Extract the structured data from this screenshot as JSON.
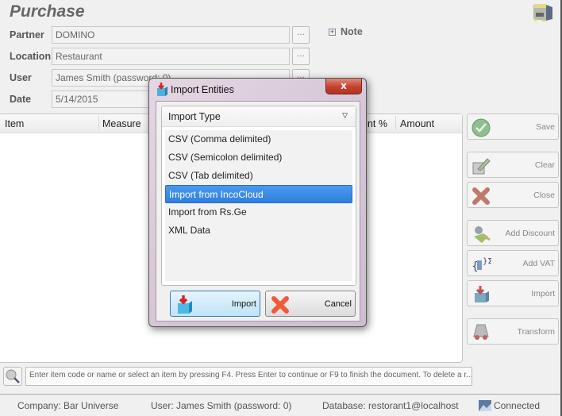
{
  "page": {
    "title": "Purchase"
  },
  "form": {
    "partner": {
      "label": "Partner",
      "value": "DOMINO",
      "browse": "..."
    },
    "location": {
      "label": "Location",
      "value": "Restaurant",
      "browse": "..."
    },
    "user": {
      "label": "User",
      "value": "James Smith (password: 0)",
      "browse": "..."
    },
    "date": {
      "label": "Date",
      "value": "5/14/2015"
    }
  },
  "note": {
    "label": "Note",
    "expander": "+"
  },
  "grid": {
    "columns": [
      "Item",
      "Measure",
      "Discount %",
      "Amount"
    ],
    "visible_partial_column": "unt %"
  },
  "side_buttons": [
    {
      "label": "Save",
      "icon": "check-icon"
    },
    {
      "label": "Clear",
      "icon": "edit-icon"
    },
    {
      "label": "Close",
      "icon": "x-icon"
    },
    {
      "label": "Add Discount",
      "icon": "discount-icon"
    },
    {
      "label": "Add VAT",
      "icon": "sigma-icon"
    },
    {
      "label": "Import",
      "icon": "import-icon"
    },
    {
      "label": "Transform",
      "icon": "transform-icon"
    }
  ],
  "search": {
    "placeholder": "Enter item code or name or select an item by pressing F4. Press Enter to continue or F9 to finish the document. To delete a r..."
  },
  "status": {
    "company": "Company: Bar Universe",
    "user": "User: James Smith (password: 0)",
    "database": "Database: restorant1@localhost",
    "connection": "Connected"
  },
  "dialog": {
    "title": "Import Entities",
    "close": "x",
    "list_header": "Import Type",
    "items": [
      "CSV (Comma delimited)",
      "CSV (Semicolon delimited)",
      "CSV (Tab delimited)",
      "Import from IncoCloud",
      "Import from Rs.Ge",
      "XML Data"
    ],
    "selected_index": 3,
    "import_label": "Import",
    "cancel_label": "Cancel"
  }
}
